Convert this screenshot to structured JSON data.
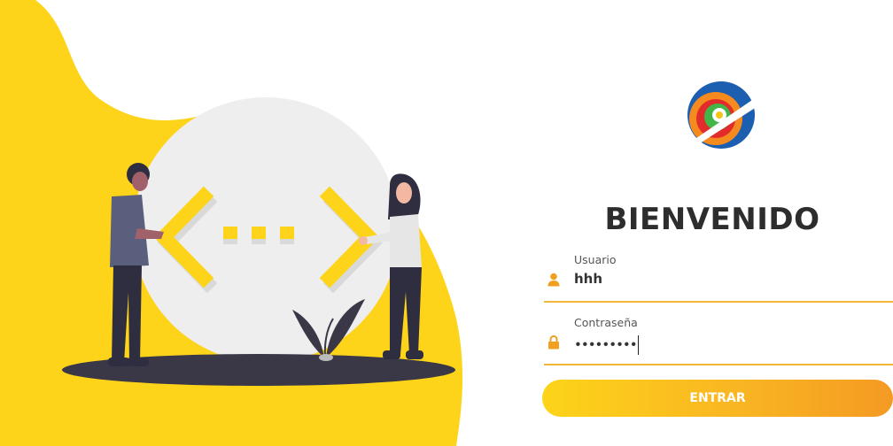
{
  "login": {
    "title": "BIENVENIDO",
    "username_label": "Usuario",
    "username_value": "hhh",
    "password_label": "Contraseña",
    "password_value": "•••••••••",
    "submit_label": "ENTRAR"
  },
  "icons": {
    "user": "user-icon",
    "lock": "lock-icon"
  },
  "colors": {
    "accent_yellow": "#fdd419",
    "accent_orange": "#f49a23",
    "title": "#2d2d2d",
    "underline": "#f0b63a"
  }
}
